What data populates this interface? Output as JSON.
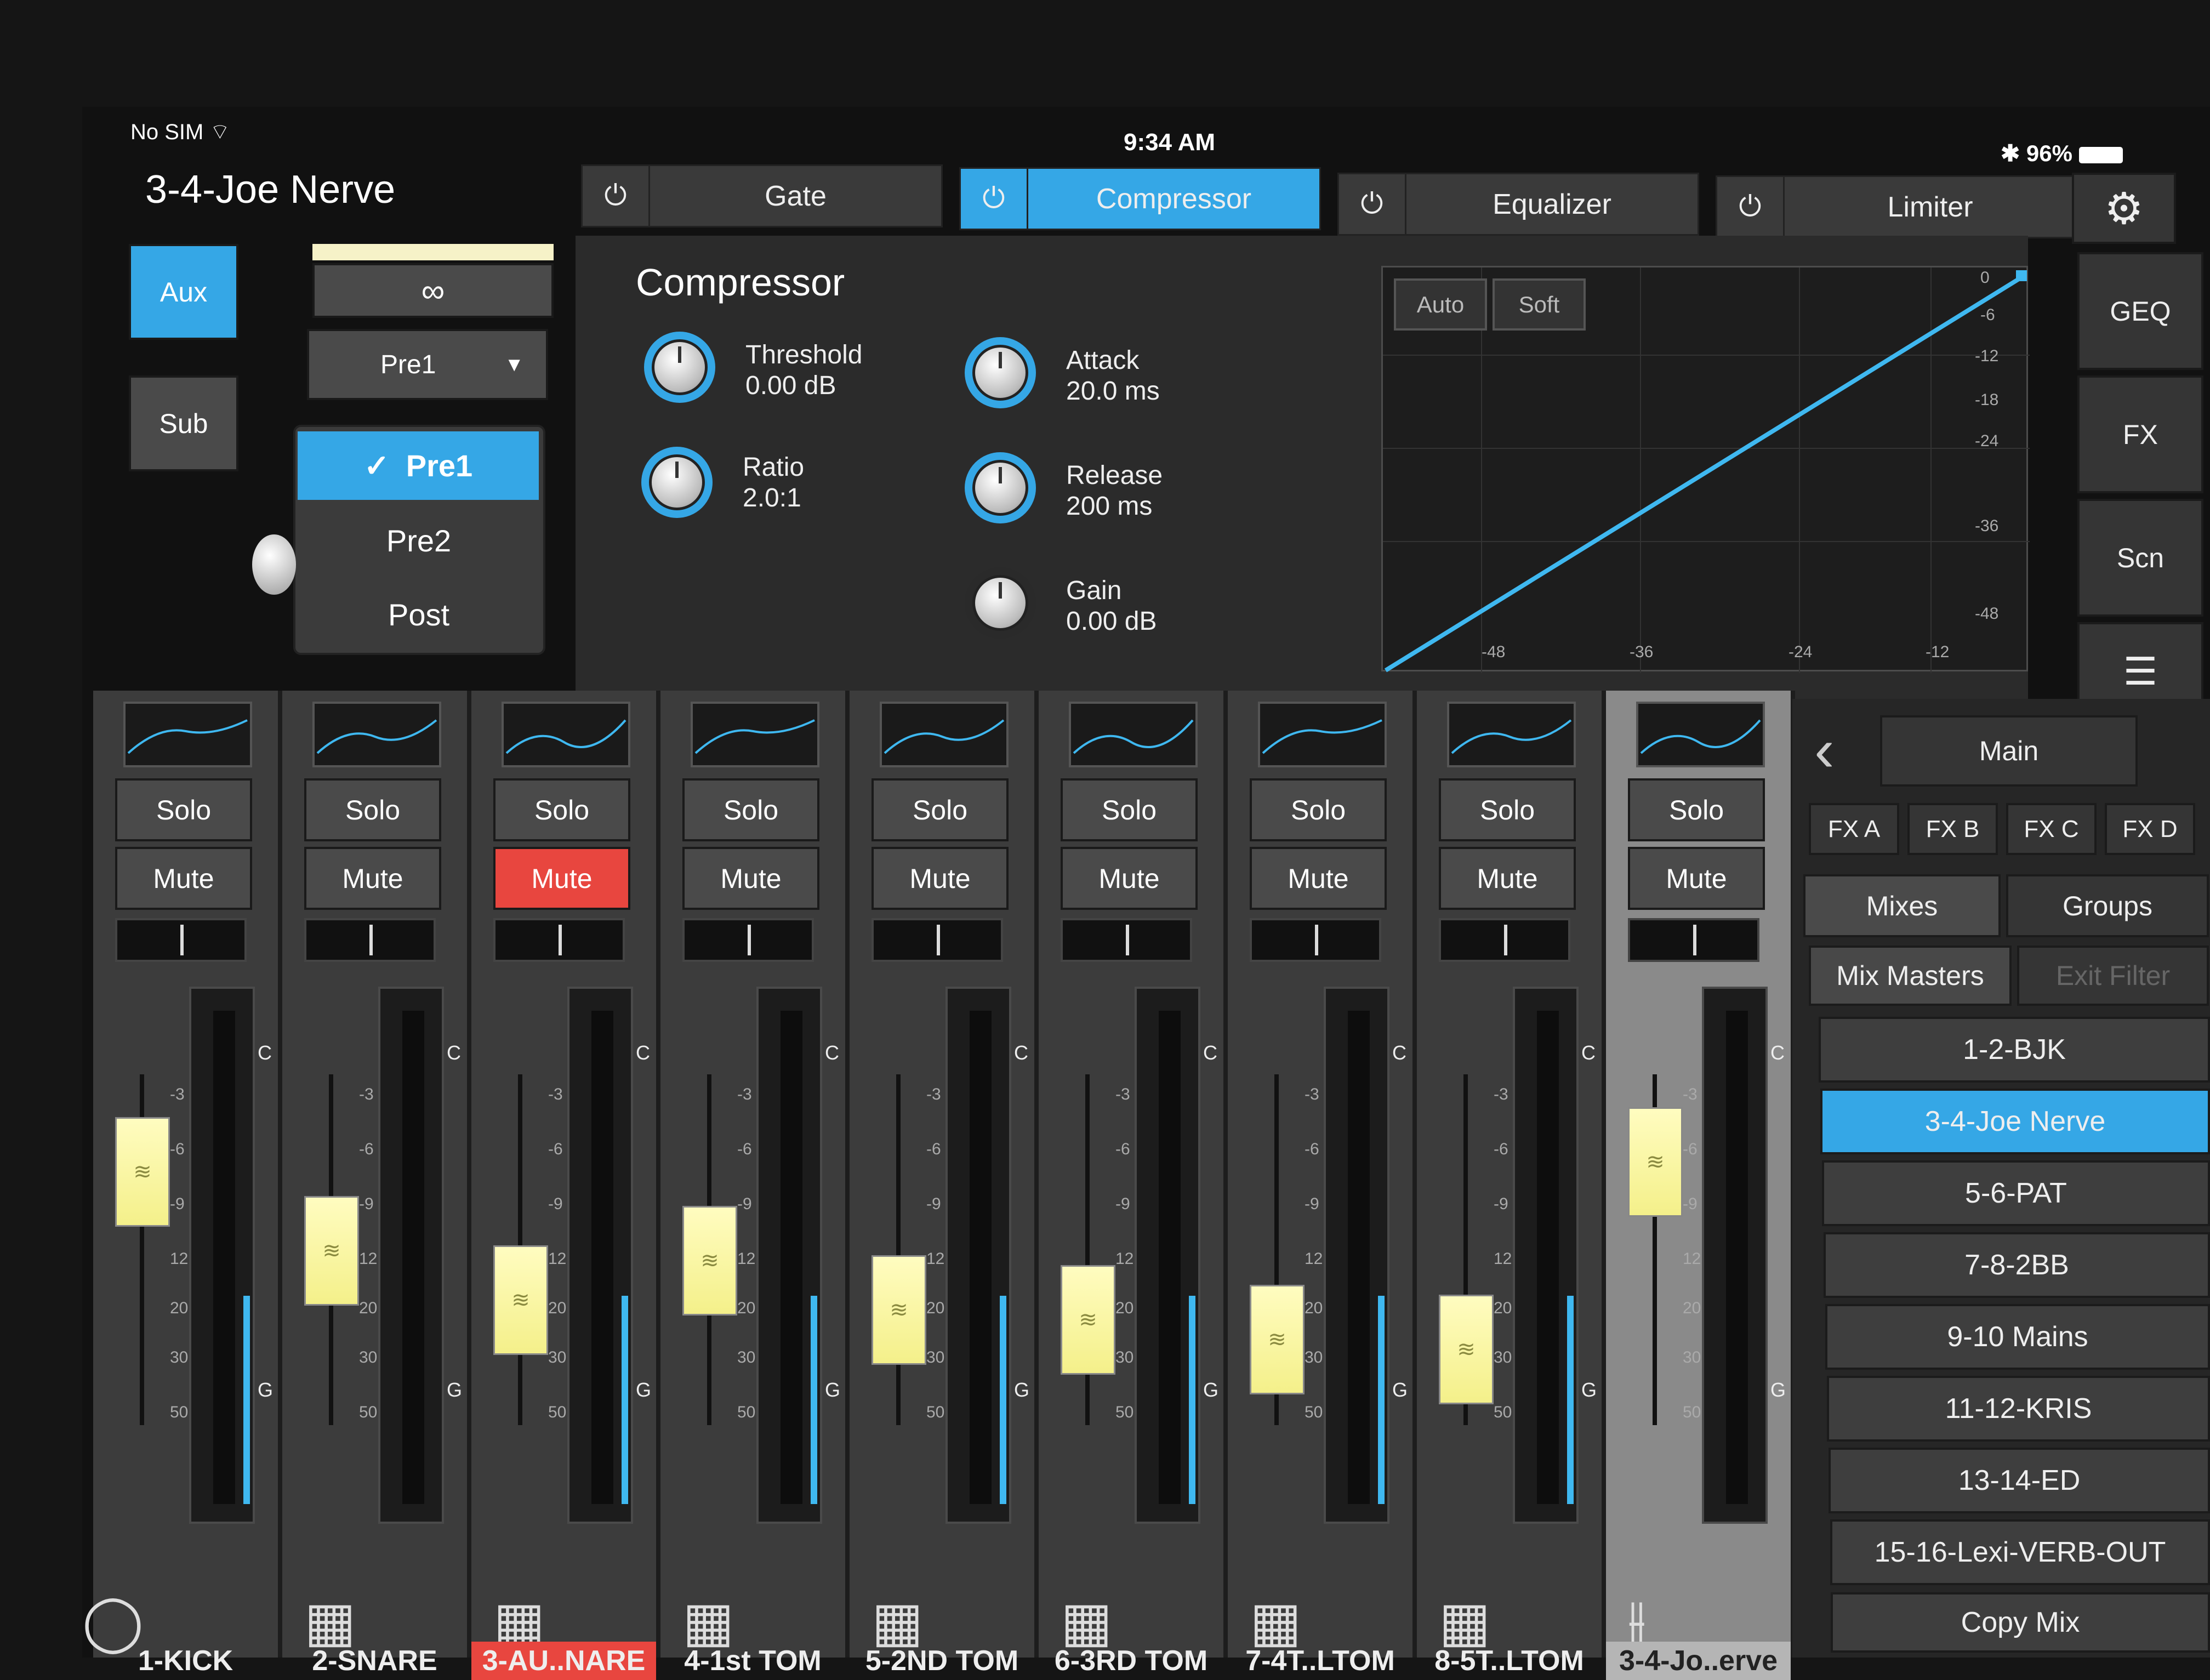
{
  "status": {
    "carrier": "No SIM",
    "time": "9:34 AM",
    "battery": "96%"
  },
  "channel_title": "3-4-Joe Nerve",
  "left_controls": {
    "aux": "Aux",
    "sub": "Sub",
    "link_icon": "link-icon",
    "source_value": "Pre1"
  },
  "source_menu": {
    "items": [
      "Pre1",
      "Pre2",
      "Post"
    ],
    "selected": "Pre1"
  },
  "tabs": {
    "gate": "Gate",
    "compressor": "Compressor",
    "equalizer": "Equalizer",
    "limiter": "Limiter"
  },
  "compressor": {
    "title": "Compressor",
    "threshold_label": "Threshold",
    "threshold_value": "0.00 dB",
    "ratio_label": "Ratio",
    "ratio_value": "2.0:1",
    "attack_label": "Attack",
    "attack_value": "20.0 ms",
    "release_label": "Release",
    "release_value": "200 ms",
    "gain_label": "Gain",
    "gain_value": "0.00 dB"
  },
  "graph": {
    "auto": "Auto",
    "soft": "Soft",
    "y_labels": [
      "0",
      "-6",
      "-12",
      "-18",
      "-24",
      "-36",
      "-48"
    ],
    "x_labels": [
      "-48",
      "-36",
      "-24",
      "-12"
    ]
  },
  "side_nav": {
    "geq": "GEQ",
    "fx": "FX",
    "scn": "Scn",
    "menu_icon": "menu-icon",
    "settings_icon": "gear-icon"
  },
  "strip_labels": {
    "solo": "Solo",
    "mute": "Mute"
  },
  "meter_scale": [
    "C",
    "-3",
    "-6",
    "-9",
    "12",
    "20",
    "30",
    "50",
    "G"
  ],
  "channels": [
    {
      "name": "1-KICK",
      "muted": false,
      "fader": 0.78,
      "icon": "kick-drum-icon"
    },
    {
      "name": "2-SNARE",
      "muted": false,
      "fader": 0.62,
      "icon": "snare-icon"
    },
    {
      "name": "3-AU..NARE",
      "muted": true,
      "fader": 0.52,
      "icon": "snare-icon"
    },
    {
      "name": "4-1st TOM",
      "muted": false,
      "fader": 0.6,
      "icon": "tom-icon"
    },
    {
      "name": "5-2ND TOM",
      "muted": false,
      "fader": 0.5,
      "icon": "tom-icon"
    },
    {
      "name": "6-3RD TOM",
      "muted": false,
      "fader": 0.48,
      "icon": "tom-icon"
    },
    {
      "name": "7-4T..LTOM",
      "muted": false,
      "fader": 0.44,
      "icon": "floor-tom-icon"
    },
    {
      "name": "8-5T..LTOM",
      "muted": false,
      "fader": 0.42,
      "icon": "floor-tom-icon"
    },
    {
      "name": "3-4-Jo..erve",
      "muted": false,
      "fader": 0.8,
      "icon": "mixer-icon"
    }
  ],
  "right_panel": {
    "main": "Main",
    "fx_buttons": [
      "FX A",
      "FX B",
      "FX C",
      "FX D"
    ],
    "tab_mixes": "Mixes",
    "tab_groups": "Groups",
    "mix_masters": "Mix Masters",
    "exit_filter": "Exit Filter",
    "mixes": [
      "1-2-BJK",
      "3-4-Joe Nerve",
      "5-6-PAT",
      "7-8-2BB",
      "9-10 Mains",
      "11-12-KRIS",
      "13-14-ED",
      "15-16-Lexi-VERB-OUT"
    ],
    "selected_mix": "3-4-Joe Nerve",
    "copy_mix": "Copy Mix"
  },
  "colors": {
    "accent": "#35a7e6",
    "mute_active": "#e8463f",
    "fader_cap": "#f4f08a"
  }
}
